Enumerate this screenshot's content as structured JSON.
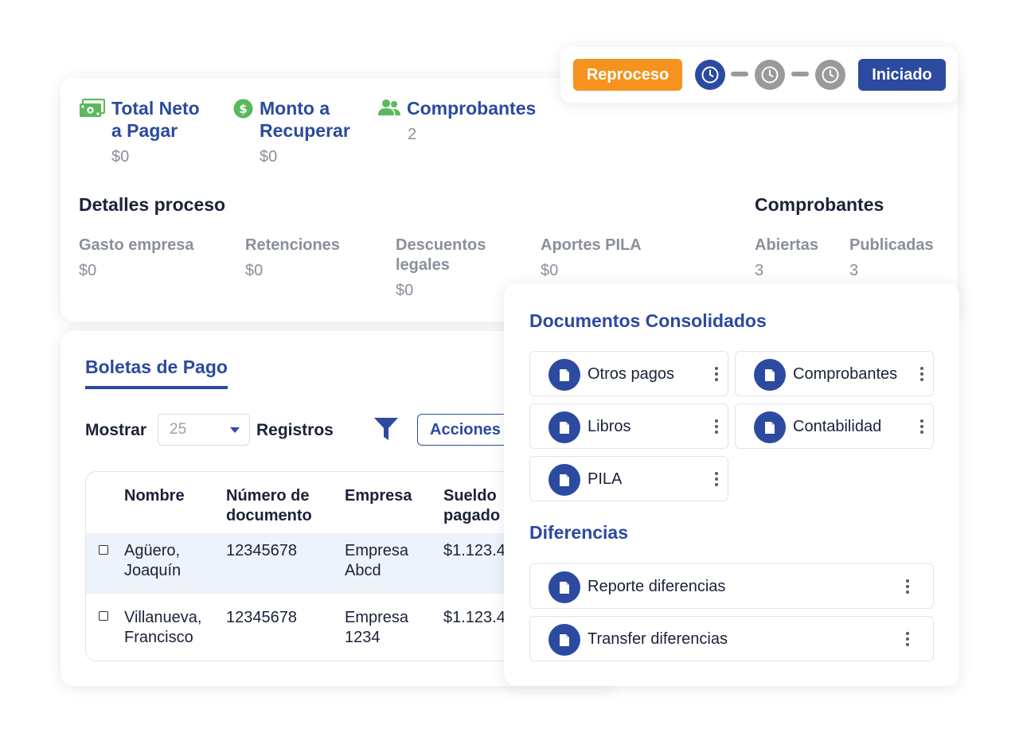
{
  "summary": {
    "kpis": [
      {
        "icon": "cash-icon",
        "title_line1": "Total Neto",
        "title_line2": "a Pagar",
        "value": "$0"
      },
      {
        "icon": "dollar-circle-icon",
        "title_line1": "Monto a",
        "title_line2": "Recuperar",
        "value": "$0"
      },
      {
        "icon": "users-icon",
        "title_line1": "Comprobantes",
        "title_line2": "",
        "value": "2"
      }
    ],
    "details_title": "Detalles proceso",
    "details": [
      {
        "label_line1": "Gasto empresa",
        "label_line2": "",
        "value": "$0"
      },
      {
        "label_line1": "Retenciones",
        "label_line2": "",
        "value": "$0"
      },
      {
        "label_line1": "Descuentos",
        "label_line2": "legales",
        "value": "$0"
      },
      {
        "label_line1": "Aportes PILA",
        "label_line2": "",
        "value": "$0"
      }
    ],
    "comprobantes_title": "Comprobantes",
    "comprobantes": [
      {
        "label": "Abiertas",
        "value": "3"
      },
      {
        "label": "Publicadas",
        "value": "3"
      }
    ]
  },
  "status": {
    "reproceso_label": "Reproceso",
    "iniciado_label": "Iniciado",
    "colors": {
      "orange": "#f5931e",
      "active": "#2b4aa0",
      "inactive": "#9a9a9a"
    }
  },
  "boletas": {
    "tab_label": "Boletas de Pago",
    "mostrar_label": "Mostrar",
    "page_size": "25",
    "registros_label": "Registros",
    "acciones_label": "Acciones",
    "columns": [
      {
        "line1": "Nombre",
        "line2": ""
      },
      {
        "line1": "Número de",
        "line2": "documento"
      },
      {
        "line1": "Empresa",
        "line2": ""
      },
      {
        "line1": "Sueldo",
        "line2": "pagado"
      }
    ],
    "rows": [
      {
        "name1": "Agüero,",
        "name2": "Joaquín",
        "doc": "12345678",
        "emp1": "Empresa",
        "emp2": "Abcd",
        "sueldo": "$1.123.4"
      },
      {
        "name1": "Villanueva,",
        "name2": "Francisco",
        "doc": "12345678",
        "emp1": "Empresa",
        "emp2": "1234",
        "sueldo": "$1.123.4"
      }
    ]
  },
  "docs": {
    "consolidados_title": "Documentos Consolidados",
    "consolidados": [
      "Otros pagos",
      "Comprobantes",
      "Libros",
      "Contabilidad",
      "PILA"
    ],
    "diferencias_title": "Diferencias",
    "diferencias": [
      "Reporte diferencias",
      "Transfer diferencias"
    ]
  }
}
